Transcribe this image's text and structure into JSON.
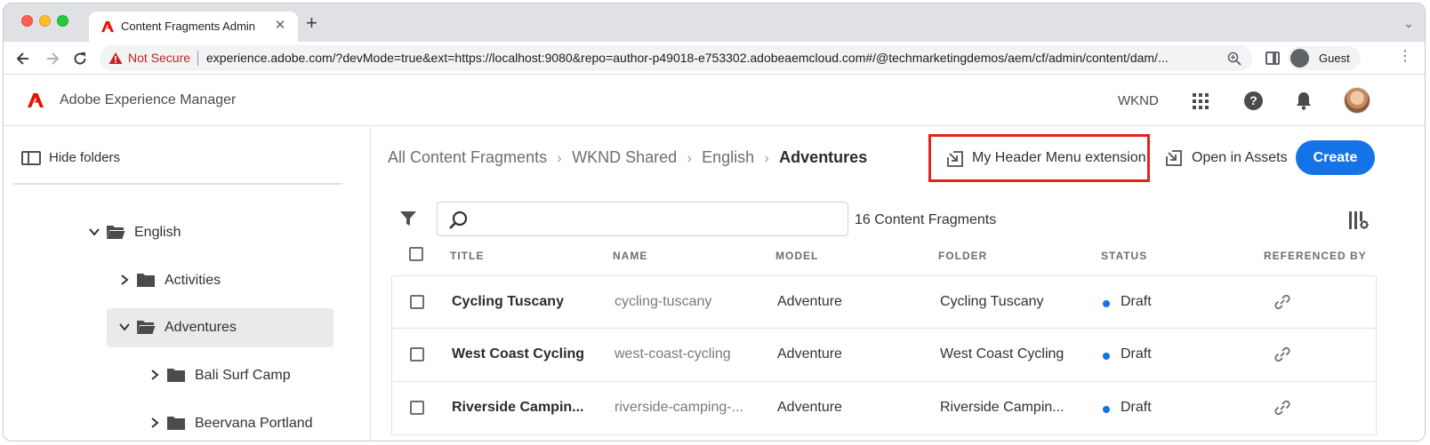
{
  "browser": {
    "tab_title": "Content Fragments Admin",
    "tab_close": "✕",
    "new_tab": "+",
    "tab_menu": "⌄",
    "not_secure": "Not Secure",
    "url": "experience.adobe.com/?devMode=true&ext=https://localhost:9080&repo=author-p49018-e753302.adobeaemcloud.com#/@techmarketingdemos/aem/cf/admin/content/dam/...",
    "profile_label": "Guest",
    "menu": "⋮"
  },
  "app": {
    "name": "Adobe Experience Manager",
    "org": "WKND",
    "help": "?",
    "brand_color": "#eb1000"
  },
  "sidebar": {
    "hide_folders": "Hide folders",
    "tree": [
      {
        "label": "English",
        "expanded": true,
        "selected": false
      },
      {
        "label": "Activities",
        "expanded": false,
        "selected": false
      },
      {
        "label": "Adventures",
        "expanded": true,
        "selected": true
      },
      {
        "label": "Bali Surf Camp",
        "expanded": false,
        "selected": false
      },
      {
        "label": "Beervana Portland",
        "expanded": false,
        "selected": false
      }
    ]
  },
  "main": {
    "breadcrumbs": [
      "All Content Fragments",
      "WKND Shared",
      "English",
      "Adventures"
    ],
    "crumb_sep": "›",
    "header_extension": "My Header Menu extension",
    "open_in_assets": "Open in Assets",
    "create": "Create",
    "accent_color": "#1473e6",
    "search_placeholder": "",
    "count": "16 Content Fragments",
    "columns": [
      "TITLE",
      "NAME",
      "MODEL",
      "FOLDER",
      "STATUS",
      "REFERENCED BY"
    ],
    "rows": [
      {
        "title": "Cycling Tuscany",
        "name": "cycling-tuscany",
        "model": "Adventure",
        "folder": "Cycling Tuscany",
        "status": "Draft"
      },
      {
        "title": "West Coast Cycling",
        "name": "west-coast-cycling",
        "model": "Adventure",
        "folder": "West Coast Cycling",
        "status": "Draft"
      },
      {
        "title": "Riverside Campin...",
        "name": "riverside-camping-...",
        "model": "Adventure",
        "folder": "Riverside Campin...",
        "status": "Draft"
      }
    ],
    "status_color": "#1473e6"
  }
}
